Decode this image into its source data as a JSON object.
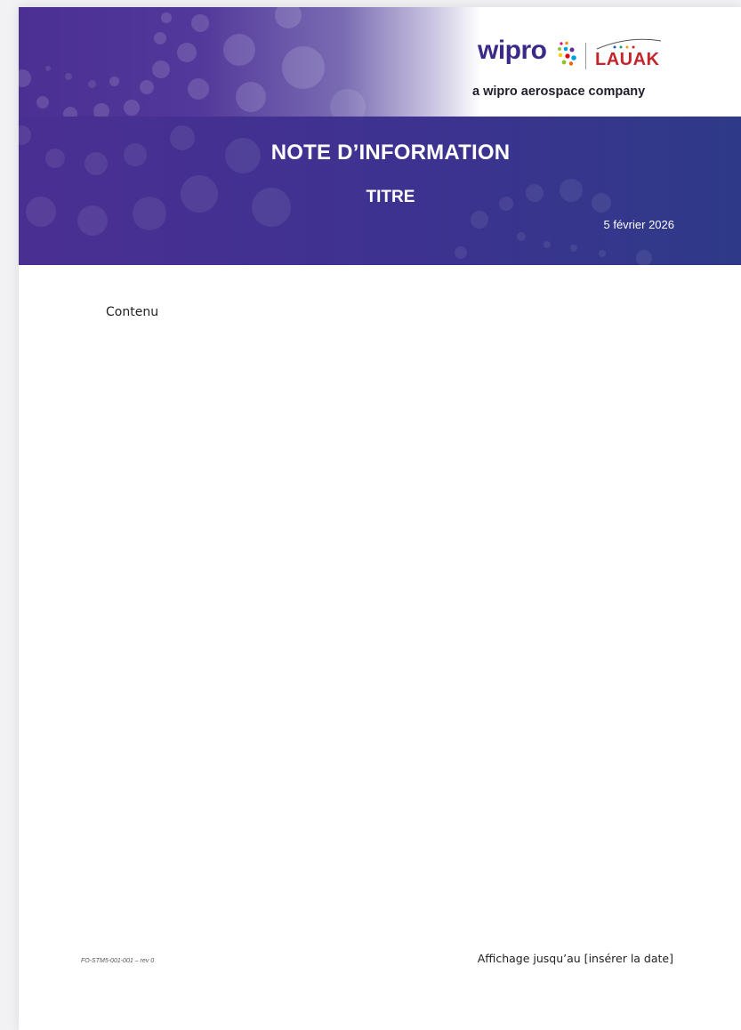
{
  "header": {
    "logo_wipro": "wipro",
    "logo_lauak": "LAUAK",
    "tagline": "a wipro aerospace company",
    "title": "NOTE D’INFORMATION",
    "subtitle": "TITRE",
    "date": "5 février 2026"
  },
  "body": {
    "content": "Contenu"
  },
  "footer": {
    "reference": "FO-STM5-001-001 – rev 0",
    "display_until": "Affichage jusqu’au [insérer la date]"
  },
  "colors": {
    "banner_purple": "#4a2f92",
    "banner_blue": "#2e3a88",
    "wipro_text": "#3b2a86",
    "lauak_red": "#c4242b"
  }
}
